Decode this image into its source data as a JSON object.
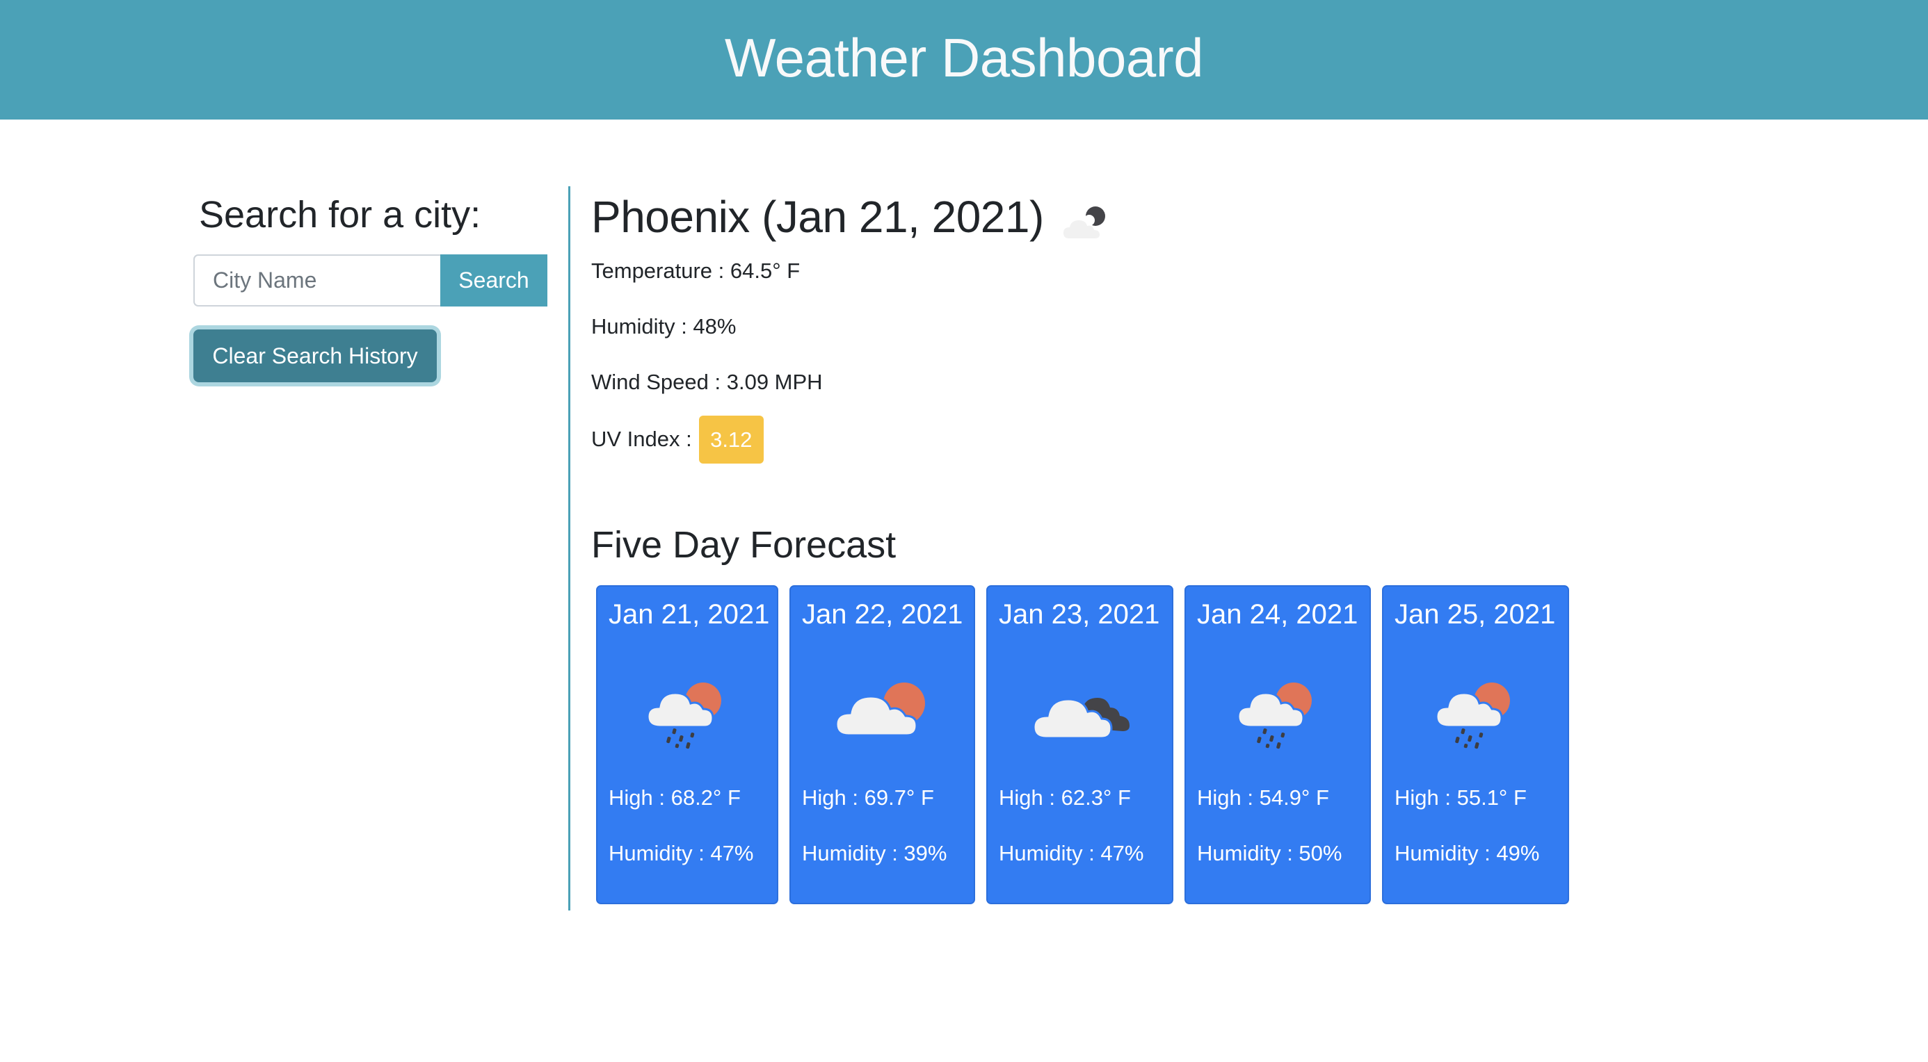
{
  "header": {
    "title": "Weather Dashboard"
  },
  "sidebar": {
    "heading": "Search for a city:",
    "search_input": {
      "value": "",
      "placeholder": "City Name"
    },
    "search_button_label": "Search",
    "clear_button_label": "Clear Search History"
  },
  "current": {
    "title": "Phoenix (Jan 21, 2021)",
    "city": "Phoenix",
    "date": "Jan 21, 2021",
    "icon": "cloud-moon-icon",
    "temperature_text": "Temperature : 64.5° F",
    "humidity_text": "Humidity : 48%",
    "wind_text": "Wind Speed : 3.09 MPH",
    "uv_label": "UV Index :",
    "uv_value": "3.12"
  },
  "forecast": {
    "title": "Five Day Forecast",
    "days": [
      {
        "date": "Jan 21, 2021",
        "icon": "rain-cloud-sun-icon",
        "high": "High : 68.2° F",
        "humidity": "Humidity : 47%"
      },
      {
        "date": "Jan 22, 2021",
        "icon": "cloud-sun-icon",
        "high": "High : 69.7° F",
        "humidity": "Humidity : 39%"
      },
      {
        "date": "Jan 23, 2021",
        "icon": "broken-clouds-icon",
        "high": "High : 62.3° F",
        "humidity": "Humidity : 47%"
      },
      {
        "date": "Jan 24, 2021",
        "icon": "rain-cloud-sun-icon",
        "high": "High : 54.9° F",
        "humidity": "Humidity : 50%"
      },
      {
        "date": "Jan 25, 2021",
        "icon": "rain-cloud-sun-icon",
        "high": "High : 55.1° F",
        "humidity": "Humidity : 49%"
      }
    ]
  },
  "colors": {
    "header_bg": "#4ba1b7",
    "clear_button_bg": "#3e7f91",
    "card_bg": "#337cf2",
    "uv_badge_bg": "#f6c445",
    "sun": "#e07558",
    "cloud": "#f1f1f1",
    "dark_cloud": "#444448"
  }
}
